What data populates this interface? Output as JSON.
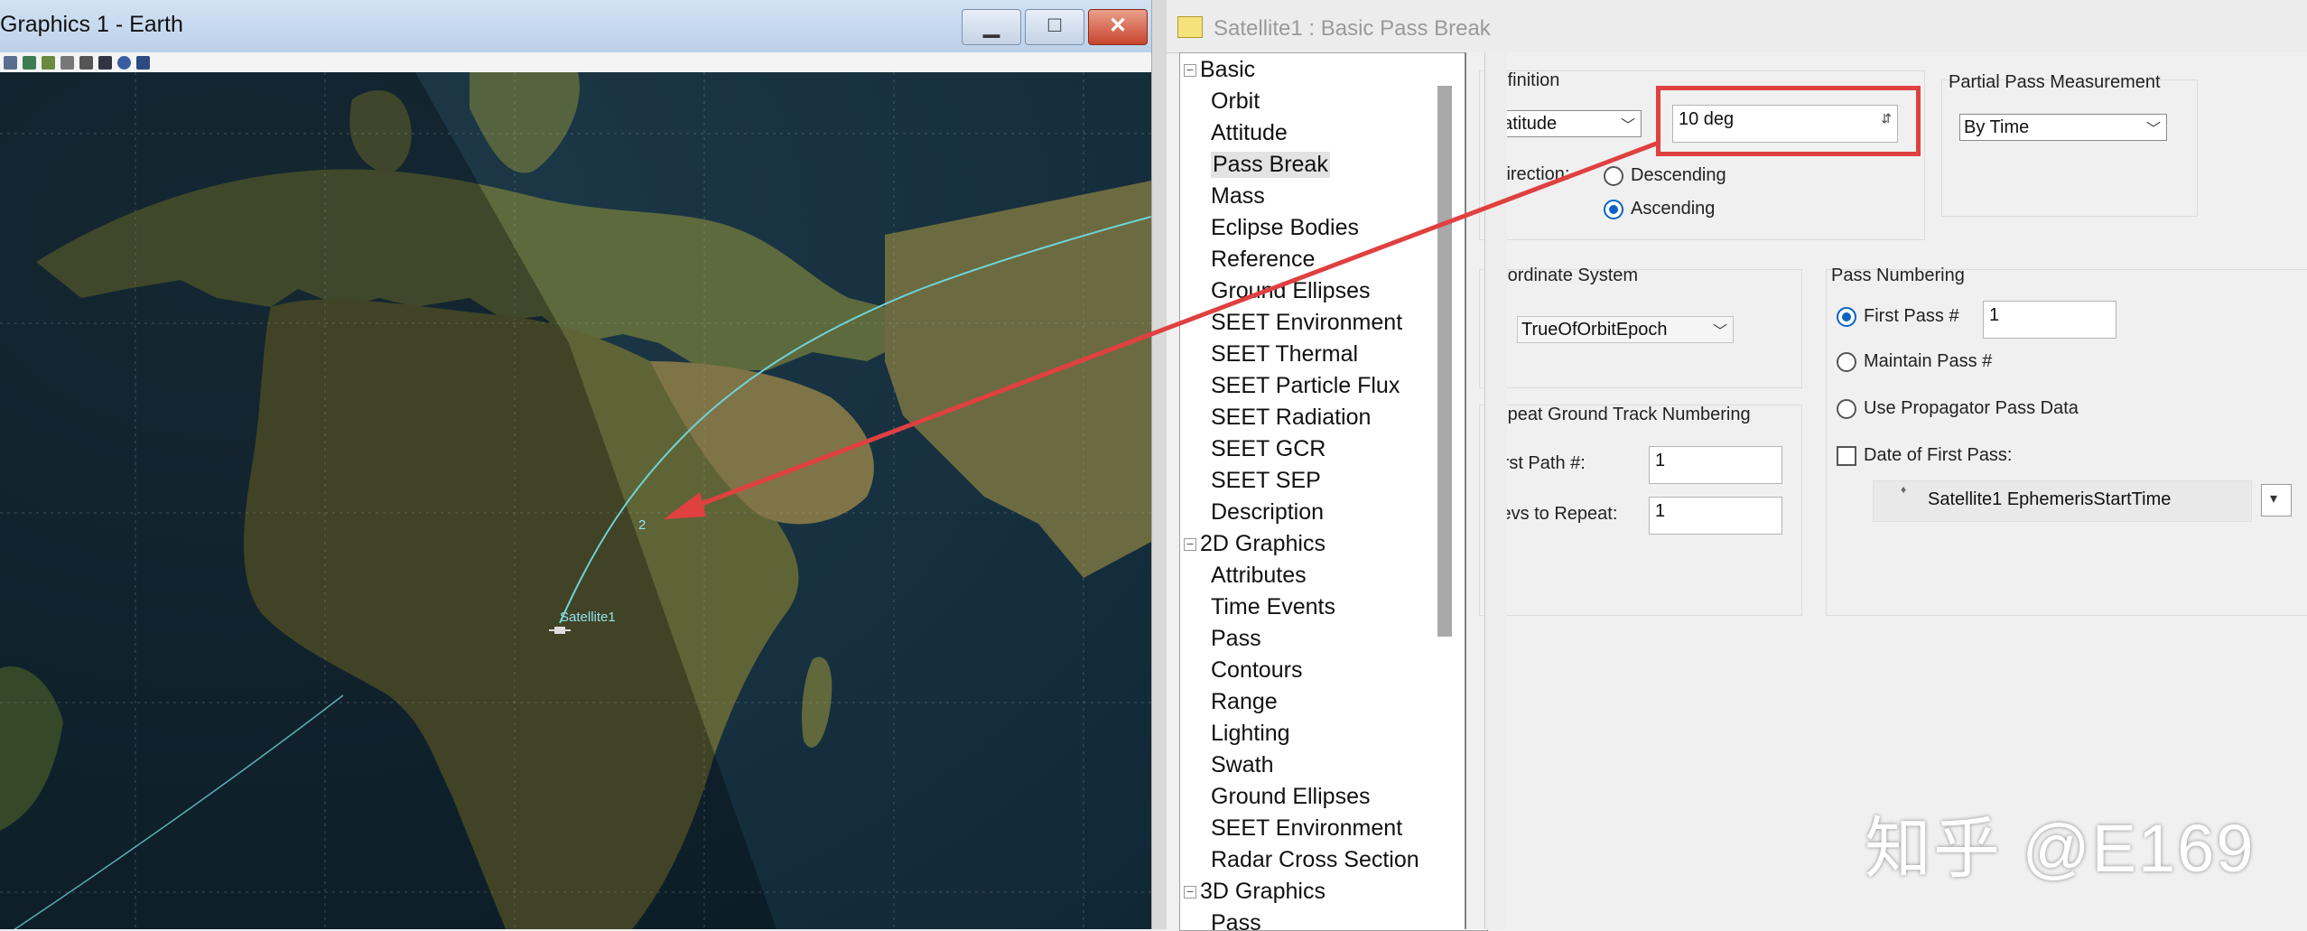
{
  "graphics_window": {
    "title": "Graphics 1 - Earth",
    "map_labels": {
      "satellite": "Satellite1",
      "pass_number": "2"
    }
  },
  "props_window": {
    "title": "Satellite1 : Basic Pass Break",
    "tree": {
      "basic": {
        "label": "Basic",
        "children": [
          "Orbit",
          "Attitude",
          "Pass Break",
          "Mass",
          "Eclipse Bodies",
          "Reference",
          "Ground Ellipses",
          "SEET Environment",
          "SEET Thermal",
          "SEET Particle Flux",
          "SEET Radiation",
          "SEET GCR",
          "SEET SEP",
          "Description"
        ]
      },
      "graphics2d": {
        "label": "2D Graphics",
        "children": [
          "Attributes",
          "Time Events",
          "Pass",
          "Contours",
          "Range",
          "Lighting",
          "Swath",
          "Ground Ellipses",
          "SEET Environment",
          "Radar Cross Section"
        ]
      },
      "graphics3d": {
        "label": "3D Graphics",
        "children": [
          "Pass"
        ]
      },
      "selected": "Pass Break"
    },
    "definition": {
      "title": "Definition",
      "type_value": "Latitude",
      "latitude_value": "10 deg",
      "direction_label": "Direction:",
      "descending_label": "Descending",
      "ascending_label": "Ascending",
      "selected_direction": "Ascending"
    },
    "partial_pass": {
      "title": "Partial Pass Measurement",
      "value": "By Time"
    },
    "coordinate_system": {
      "title": "Coordinate System",
      "value": "TrueOfOrbitEpoch"
    },
    "pass_numbering": {
      "title": "Pass Numbering",
      "first_pass_label": "First Pass #",
      "first_pass_value": "1",
      "maintain_label": "Maintain Pass #",
      "propagator_label": "Use Propagator Pass Data",
      "date_label": "Date of First Pass:",
      "date_value": "Satellite1 EphemerisStartTime",
      "selected": "First Pass #",
      "date_checked": false
    },
    "repeat_ground_track": {
      "title": "Repeat Ground Track Numbering",
      "first_path_label": "First Path #:",
      "first_path_value": "1",
      "revs_label": "Revs to Repeat:",
      "revs_value": "1"
    }
  },
  "watermark": "知乎 @E169",
  "colors": {
    "annotation_red": "#e04040",
    "radio_blue": "#0a63c4",
    "ground_track": "#6fd3d6"
  },
  "icons": [
    "minimize-icon",
    "maximize-icon",
    "close-icon",
    "dropdown-arrow-icon",
    "tree-collapse-icon",
    "note-icon",
    "satellite-icon"
  ]
}
